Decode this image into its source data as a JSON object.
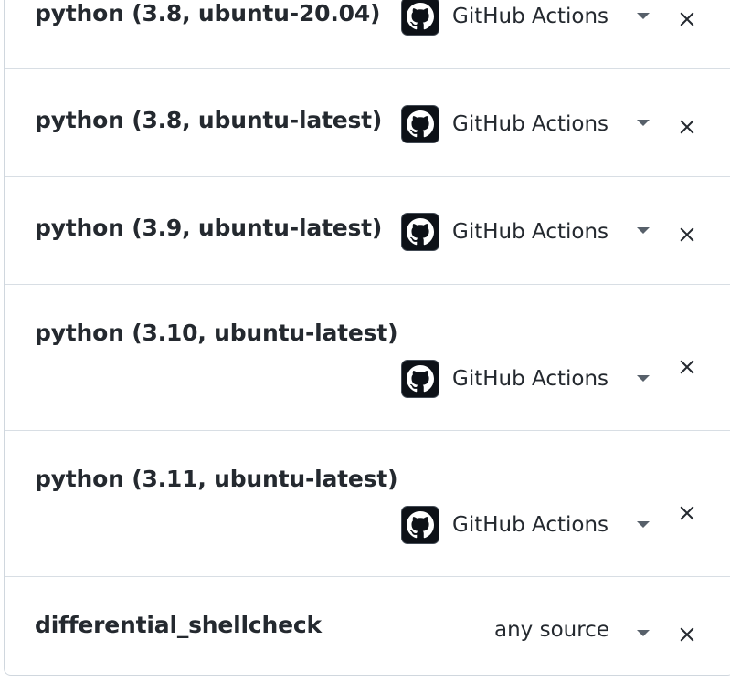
{
  "rows": [
    {
      "name": "python (3.8, ubuntu-20.04)",
      "source": "GitHub Actions",
      "source_icon": "github-mark-icon",
      "remove_icon": "close-icon"
    },
    {
      "name": "python (3.8, ubuntu-latest)",
      "source": "GitHub Actions",
      "source_icon": "github-mark-icon",
      "remove_icon": "close-icon"
    },
    {
      "name": "python (3.9, ubuntu-latest)",
      "source": "GitHub Actions",
      "source_icon": "github-mark-icon",
      "remove_icon": "close-icon"
    },
    {
      "name": "python (3.10, ubuntu-latest)",
      "source": "GitHub Actions",
      "source_icon": "github-mark-icon",
      "remove_icon": "close-icon"
    },
    {
      "name": "python (3.11, ubuntu-latest)",
      "source": "GitHub Actions",
      "source_icon": "github-mark-icon",
      "remove_icon": "close-icon"
    },
    {
      "name": "differential_shellcheck",
      "source": "any source",
      "source_icon": "",
      "remove_icon": "close-icon"
    }
  ],
  "colors": {
    "border": "#d0d7de",
    "text": "#24292f",
    "muted": "#57606a",
    "logo_bg": "#0d1117"
  }
}
